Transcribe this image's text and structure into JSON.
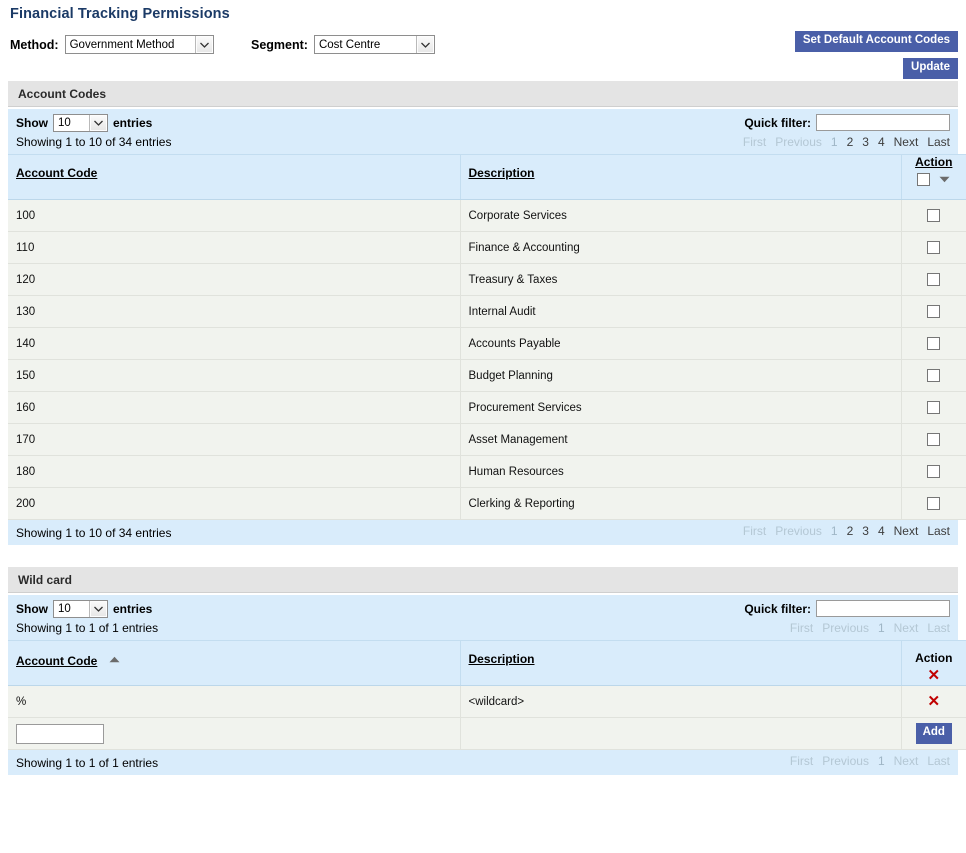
{
  "page": {
    "title": "Financial Tracking Permissions"
  },
  "controls": {
    "method_label": "Method:",
    "method_value": "Government Method",
    "segment_label": "Segment:",
    "segment_value": "Cost Centre",
    "set_defaults_label": "Set Default Account Codes",
    "update_label": "Update"
  },
  "account_codes": {
    "section_title": "Account Codes",
    "show_label": "Show",
    "entries_label": "entries",
    "page_length": "10",
    "quick_filter_label": "Quick filter:",
    "quick_filter_value": "",
    "quick_filter_placeholder": "",
    "info": "Showing 1 to 10 of 34 entries",
    "pager": {
      "first": "First",
      "previous": "Previous",
      "pages": [
        "1",
        "2",
        "3",
        "4"
      ],
      "current_page": "1",
      "next": "Next",
      "last": "Last"
    },
    "columns": {
      "code": "Account Code",
      "description": "Description",
      "action": "Action"
    },
    "rows": [
      {
        "code": "100",
        "description": "Corporate Services"
      },
      {
        "code": "110",
        "description": "Finance & Accounting"
      },
      {
        "code": "120",
        "description": "Treasury & Taxes"
      },
      {
        "code": "130",
        "description": "Internal Audit"
      },
      {
        "code": "140",
        "description": "Accounts Payable"
      },
      {
        "code": "150",
        "description": "Budget Planning"
      },
      {
        "code": "160",
        "description": "Procurement Services"
      },
      {
        "code": "170",
        "description": "Asset Management"
      },
      {
        "code": "180",
        "description": "Human Resources"
      },
      {
        "code": "200",
        "description": "Clerking & Reporting"
      }
    ]
  },
  "wild_card": {
    "section_title": "Wild card",
    "show_label": "Show",
    "entries_label": "entries",
    "page_length": "10",
    "quick_filter_label": "Quick filter:",
    "quick_filter_value": "",
    "quick_filter_placeholder": "",
    "info": "Showing 1 to 1 of 1 entries",
    "pager": {
      "first": "First",
      "previous": "Previous",
      "pages": [
        "1"
      ],
      "current_page": "1",
      "next": "Next",
      "last": "Last"
    },
    "columns": {
      "code": "Account Code",
      "description": "Description",
      "action": "Action"
    },
    "sort": "ascending",
    "rows": [
      {
        "code": "%",
        "description": "<wildcard>"
      }
    ],
    "add_row": {
      "input_value": "",
      "input_placeholder": "",
      "add_label": "Add"
    }
  },
  "icons": {
    "chevron_down": "chevron-down-icon",
    "caret_down": "caret-down-icon",
    "sort_asc": "sort-ascending-icon",
    "delete_x": "delete-x-icon"
  },
  "colors": {
    "accent_button": "#4a5fa8",
    "title": "#1b3a66",
    "table_header_bg": "#d9ecfb",
    "row_bg": "#f1f3ee",
    "section_bar_bg": "#e4e4e4",
    "delete_red": "#c00000"
  }
}
